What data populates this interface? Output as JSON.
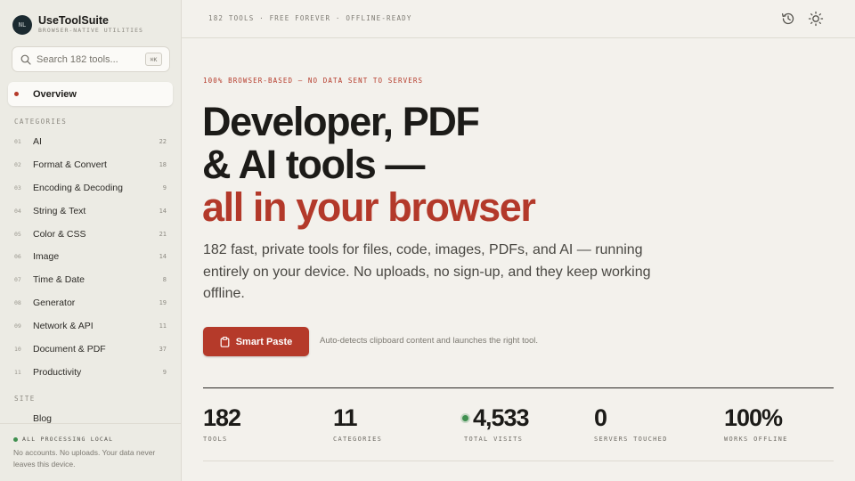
{
  "brand": {
    "logo_text": "NL",
    "name": "UseToolSuite",
    "tagline": "BROWSER-NATIVE UTILITIES"
  },
  "search": {
    "placeholder": "Search 182 tools...",
    "shortcut": "⌘K"
  },
  "nav": {
    "overview_label": "Overview"
  },
  "categories": {
    "heading": "CATEGORIES",
    "items": [
      {
        "num": "01",
        "label": "AI",
        "count": "22"
      },
      {
        "num": "02",
        "label": "Format & Convert",
        "count": "18"
      },
      {
        "num": "03",
        "label": "Encoding & Decoding",
        "count": "9"
      },
      {
        "num": "04",
        "label": "String & Text",
        "count": "14"
      },
      {
        "num": "05",
        "label": "Color & CSS",
        "count": "21"
      },
      {
        "num": "06",
        "label": "Image",
        "count": "14"
      },
      {
        "num": "07",
        "label": "Time & Date",
        "count": "8"
      },
      {
        "num": "08",
        "label": "Generator",
        "count": "19"
      },
      {
        "num": "09",
        "label": "Network & API",
        "count": "11"
      },
      {
        "num": "10",
        "label": "Document & PDF",
        "count": "37"
      },
      {
        "num": "11",
        "label": "Productivity",
        "count": "9"
      }
    ]
  },
  "site": {
    "heading": "SITE",
    "items": [
      {
        "label": "Blog"
      }
    ]
  },
  "sidebar_footer": {
    "status": "ALL PROCESSING LOCAL",
    "description": "No accounts. No uploads. Your data never leaves this device."
  },
  "topbar": {
    "text": "182 TOOLS · FREE FOREVER · OFFLINE-READY",
    "icons": [
      "history-icon",
      "sun-icon"
    ]
  },
  "hero": {
    "eyebrow": "100% BROWSER-BASED — NO DATA SENT TO SERVERS",
    "title_line1": "Developer, PDF",
    "title_line2": "& AI tools —",
    "title_line3": "all in your browser",
    "lede": "182 fast, private tools for files, code, images, PDFs, and AI — running entirely on your device. No uploads, no sign-up, and they keep working offline.",
    "cta_label": "Smart Paste",
    "cta_note": "Auto-detects clipboard content and launches the right tool."
  },
  "stats": [
    {
      "value": "182",
      "label": "TOOLS"
    },
    {
      "value": "11",
      "label": "CATEGORIES"
    },
    {
      "value": "4,533",
      "label": "TOTAL VISITS"
    },
    {
      "value": "0",
      "label": "SERVERS TOUCHED"
    },
    {
      "value": "100%",
      "label": "WORKS OFFLINE"
    }
  ],
  "colors": {
    "accent": "#b53a2a",
    "live": "#3f8f4f",
    "background": "#f3f1ec",
    "sidebar": "#ecebe4"
  }
}
